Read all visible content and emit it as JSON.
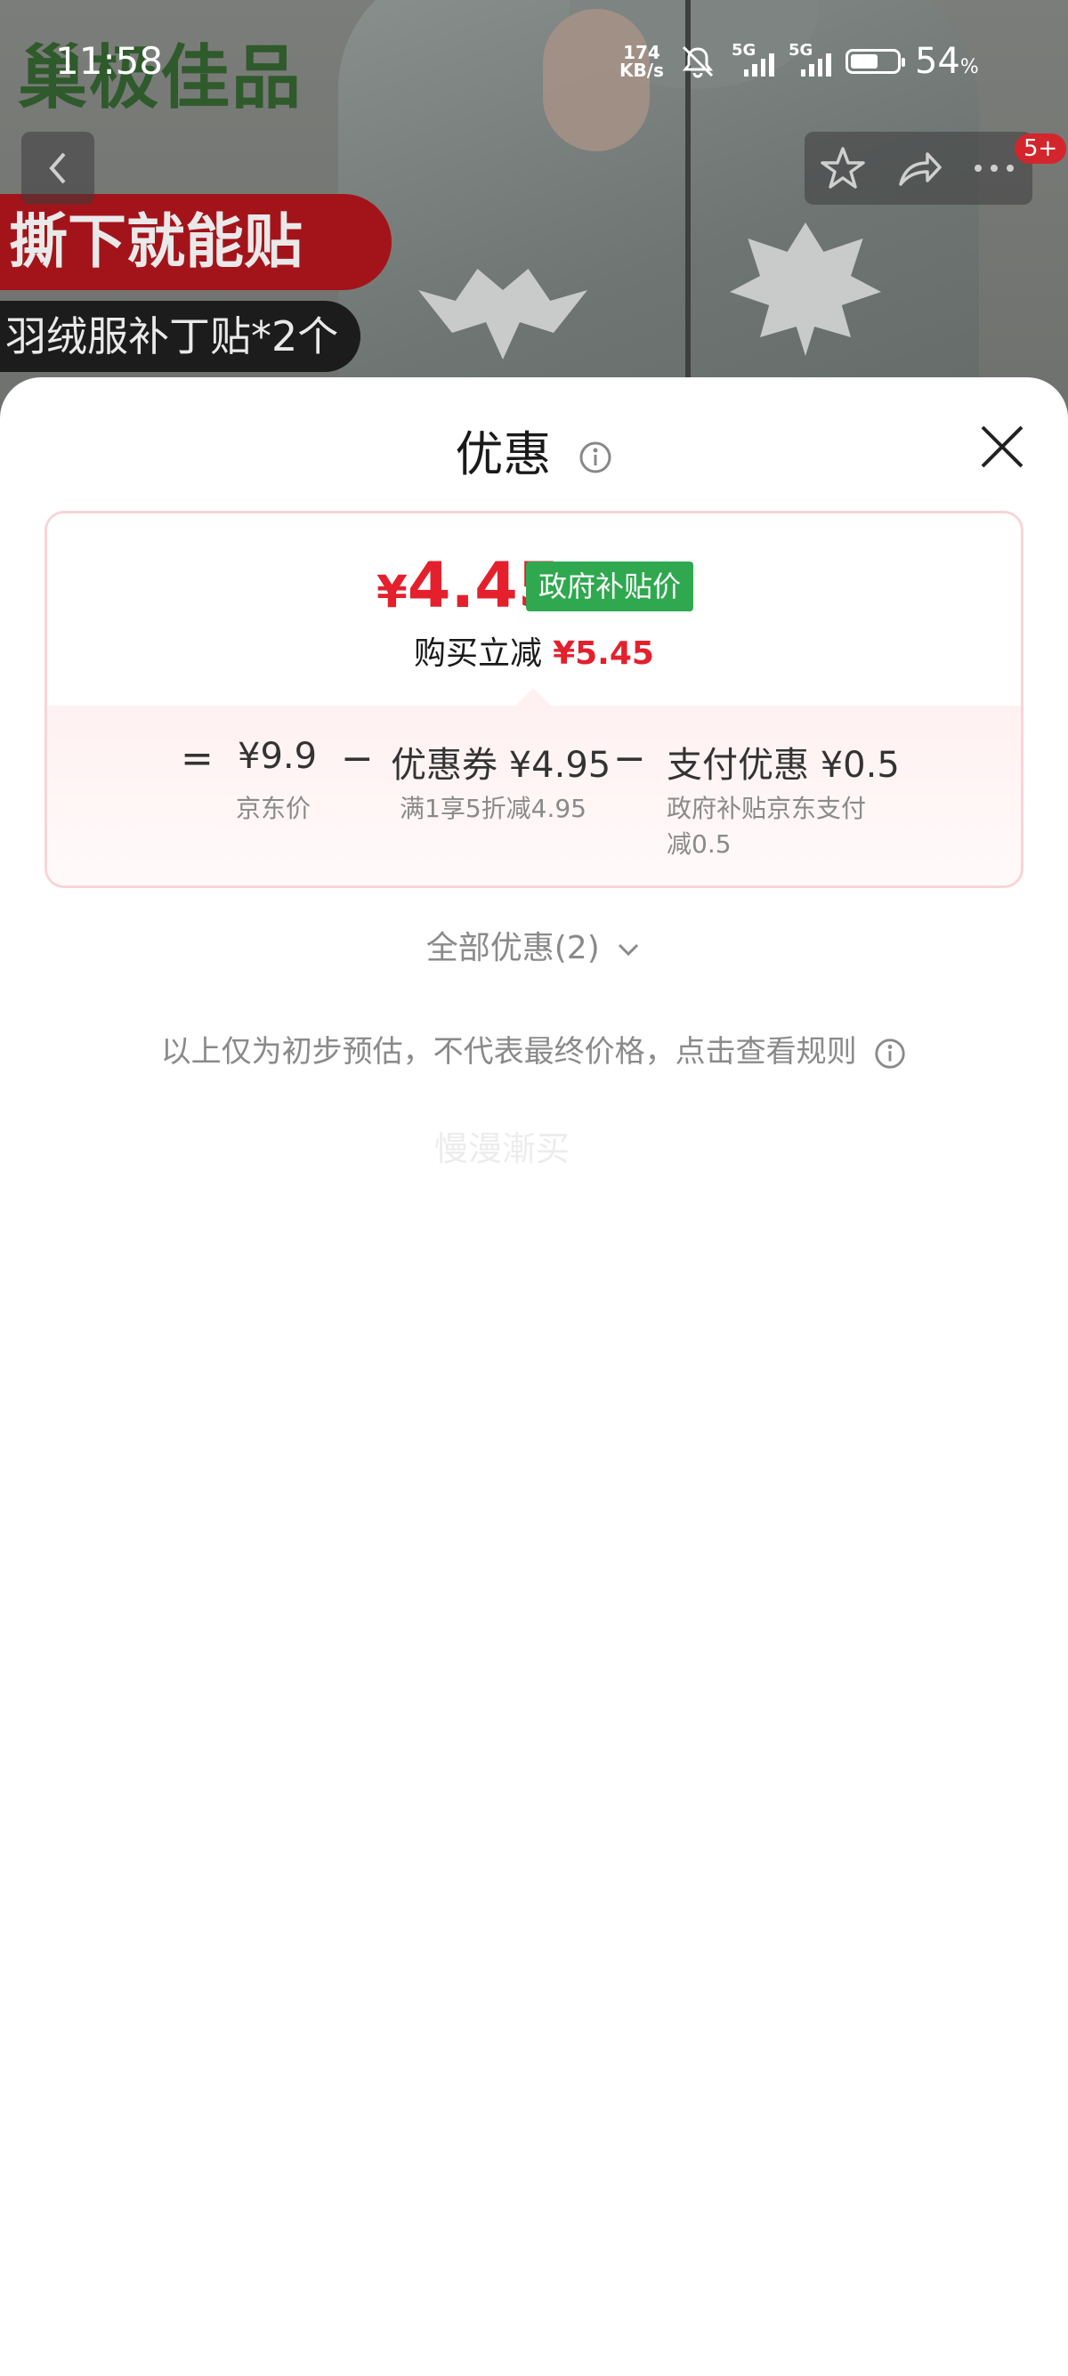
{
  "status_bar": {
    "time": "11:58",
    "net_speed_value": "174",
    "net_speed_unit": "KB/s",
    "signal1_label": "5G",
    "signal2_label": "5G",
    "battery_percent": "54",
    "battery_unit": "%"
  },
  "product_image": {
    "brand_logo": "巢极佳品",
    "promo_line1": "撕下就能贴",
    "promo_line2": "羽绒服补丁贴*2个"
  },
  "nav": {
    "cart_badge": "5+"
  },
  "sheet": {
    "title": "优惠",
    "final_price_currency": "¥",
    "final_price_value": "4.45",
    "gov_tag": "政府补贴价",
    "save_label": "购买立减",
    "save_amount": "¥5.45",
    "formula": {
      "eq": "=",
      "base_value": "¥9.9",
      "base_label": "京东价",
      "minus1": "−",
      "coupon_value": "优惠券 ¥4.95",
      "coupon_desc": "满1享5折减4.95",
      "minus2": "−",
      "pay_value": "支付优惠 ¥0.5",
      "pay_desc_line1": "政府补贴京东支付",
      "pay_desc_line2": "减0.5"
    },
    "all_offers": "全部优惠(2)",
    "disclaimer": "以上仅为初步预估，不代表最终价格，点击查看规则",
    "ghost_text": "慢漫漸买"
  },
  "colors": {
    "accent_red": "#e4202d",
    "gov_green": "#2fa84f",
    "card_border": "#f7d5d8"
  }
}
